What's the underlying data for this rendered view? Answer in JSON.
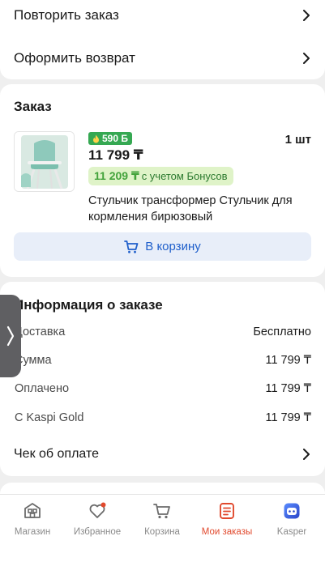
{
  "actions": {
    "repeat_order": "Повторить заказ",
    "return": "Оформить возврат"
  },
  "order": {
    "title": "Заказ",
    "bonus_badge": "590 Б",
    "quantity": "1 шт",
    "price": "11 799 ₸",
    "bonus_price": "11 209 ₸",
    "bonus_note": "с учетом Бонусов",
    "product_name": "Стульчик трансформер Стульчик для кормления бирюзовый",
    "add_to_cart": "В корзину"
  },
  "info": {
    "title": "Информация о заказе",
    "rows": [
      {
        "label": "Доставка",
        "value": "Бесплатно"
      },
      {
        "label": "Сумма",
        "value": "11 799 ₸"
      },
      {
        "label": "Оплачено",
        "value": "11 799 ₸"
      },
      {
        "label": "С Kaspi Gold",
        "value": "11 799 ₸"
      }
    ],
    "receipt": "Чек об оплате"
  },
  "tabbar": {
    "items": [
      {
        "label": "Магазин",
        "icon": "shop-icon",
        "active": false
      },
      {
        "label": "Избранное",
        "icon": "heart-icon",
        "active": false
      },
      {
        "label": "Корзина",
        "icon": "cart-icon",
        "active": false
      },
      {
        "label": "Мои заказы",
        "icon": "orders-icon",
        "active": true
      },
      {
        "label": "Kasper",
        "icon": "kasper-icon",
        "active": false
      }
    ]
  },
  "colors": {
    "accent_red": "#e1492d",
    "bonus_green": "#35a852",
    "link_blue": "#1f5fcb"
  }
}
